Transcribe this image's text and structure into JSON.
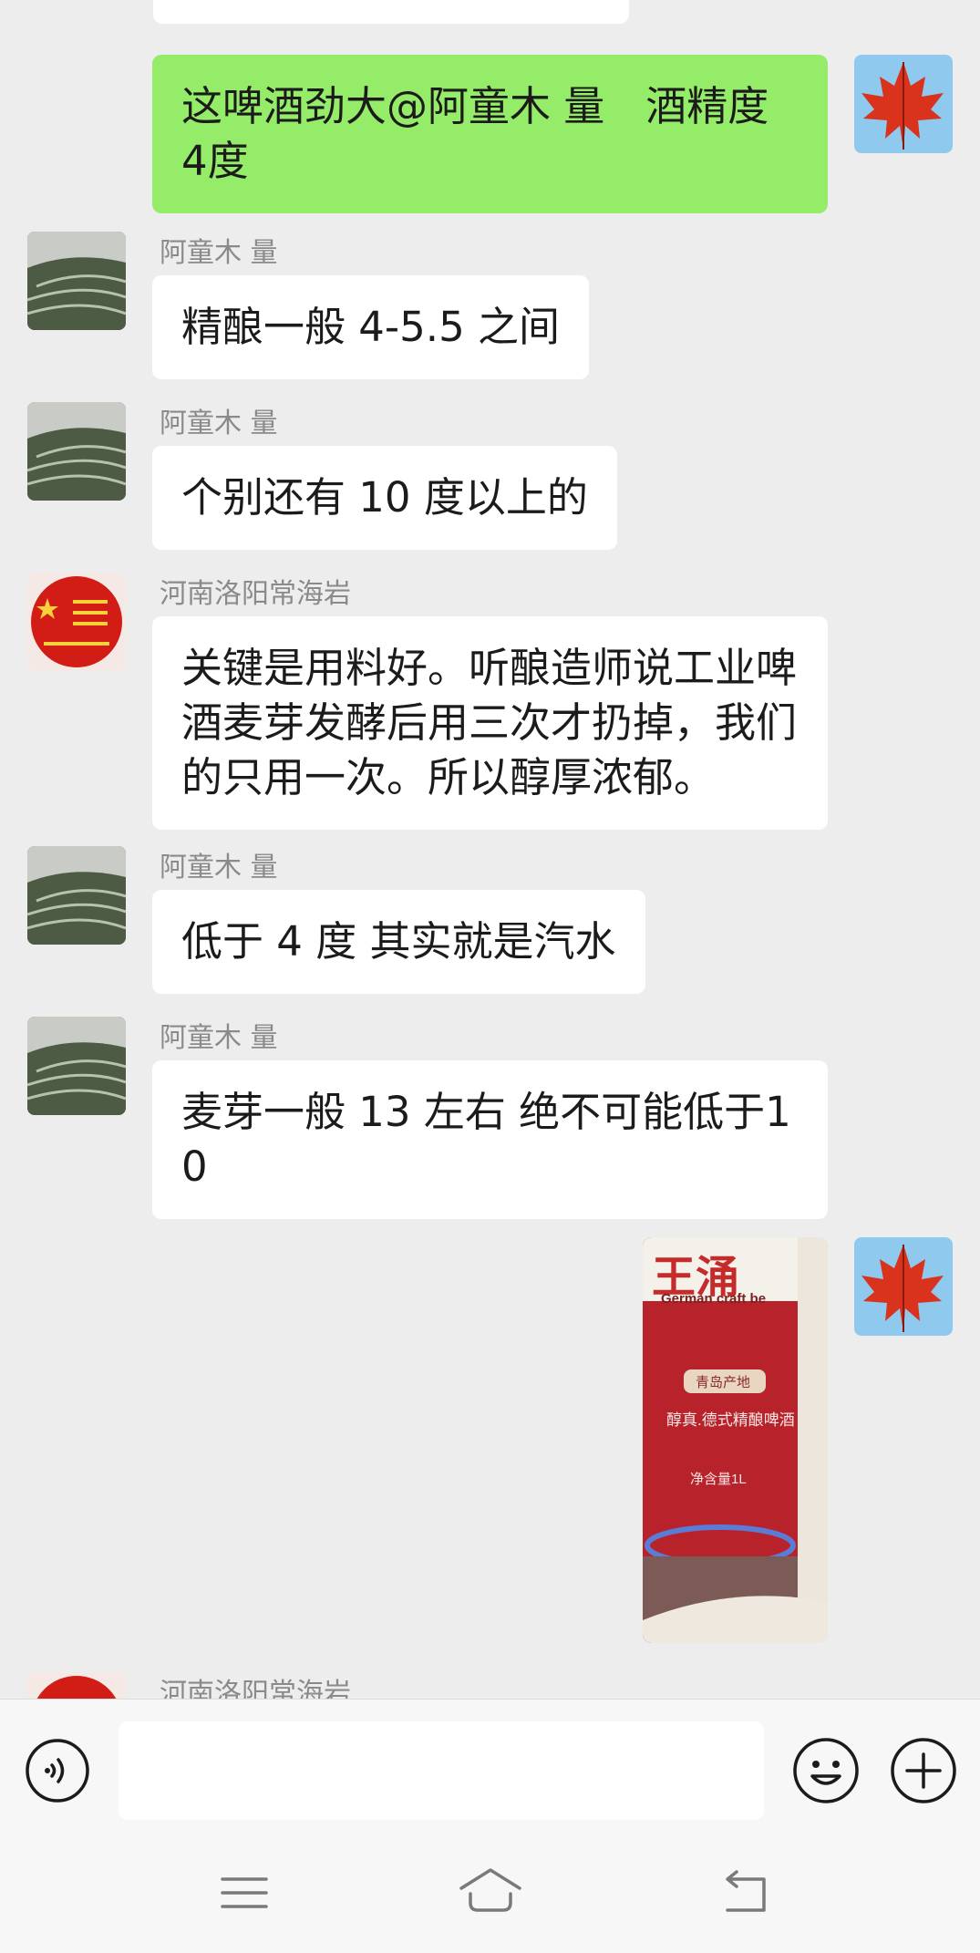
{
  "messages": [
    {
      "sender": "me",
      "text": "这啤酒劲大@阿童木 量　酒精度 4度"
    },
    {
      "sender": "阿童木 量",
      "text": "精酿一般 4-5.5 之间"
    },
    {
      "sender": "阿童木 量",
      "text": "个别还有 10 度以上的"
    },
    {
      "sender": "河南洛阳常海岩",
      "text": "关键是用料好。听酿造师说工业啤酒麦芽发酵后用三次才扔掉，我们的只用一次。所以醇厚浓郁。"
    },
    {
      "sender": "阿童木 量",
      "text": "低于 4 度 其实就是汽水"
    },
    {
      "sender": "阿童木 量",
      "text": "麦芽一般 13 左右 绝不可能低于10"
    },
    {
      "sender": "me",
      "type": "image",
      "image_text": [
        "German craft be",
        "青岛产地",
        "醇真.德式精酿啤酒",
        "净含量1L"
      ]
    },
    {
      "sender": "河南洛阳常海岩",
      "text": ""
    }
  ],
  "input": {
    "value": "",
    "placeholder": ""
  },
  "icons": {
    "voice": "voice-icon",
    "emoji": "emoji-icon",
    "more": "plus-icon",
    "nav_menu": "menu-icon",
    "nav_home": "home-icon",
    "nav_back": "back-icon"
  },
  "colors": {
    "background": "#ededed",
    "my_bubble": "#95ec69",
    "other_bubble": "#ffffff",
    "name_text": "#8a8a8a"
  }
}
